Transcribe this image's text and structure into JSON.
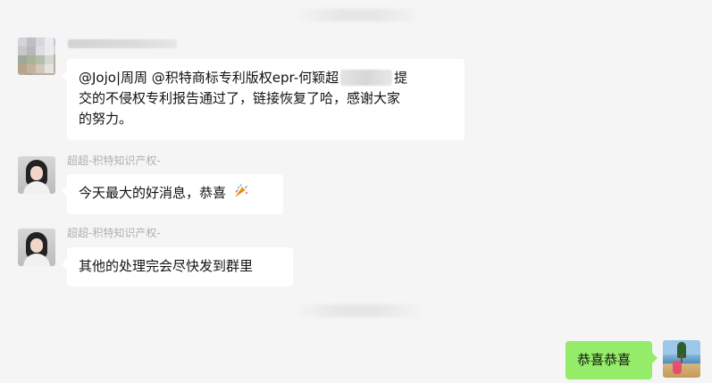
{
  "messages": {
    "first": {
      "line1": "@Jojo|周周 @积特商标专利版权epr-何颖超",
      "line1_tail": "提",
      "line2": "交的不侵权专利报告通过了，链接恢复了哈，感谢大家",
      "line3": "的努力。"
    },
    "second": {
      "sender": "超超-积特知识产权-",
      "text": "今天最大的好消息，恭喜"
    },
    "third": {
      "sender": "超超-积特知识产权-",
      "text": "其他的处理完会尽快发到群里"
    },
    "mine": {
      "text": "恭喜恭喜"
    }
  },
  "icons": {
    "party": "party-popper-icon"
  },
  "colors": {
    "background": "#f5f5f5",
    "incoming_bubble": "#ffffff",
    "outgoing_bubble": "#95ec69",
    "name": "#b0b0b0"
  }
}
